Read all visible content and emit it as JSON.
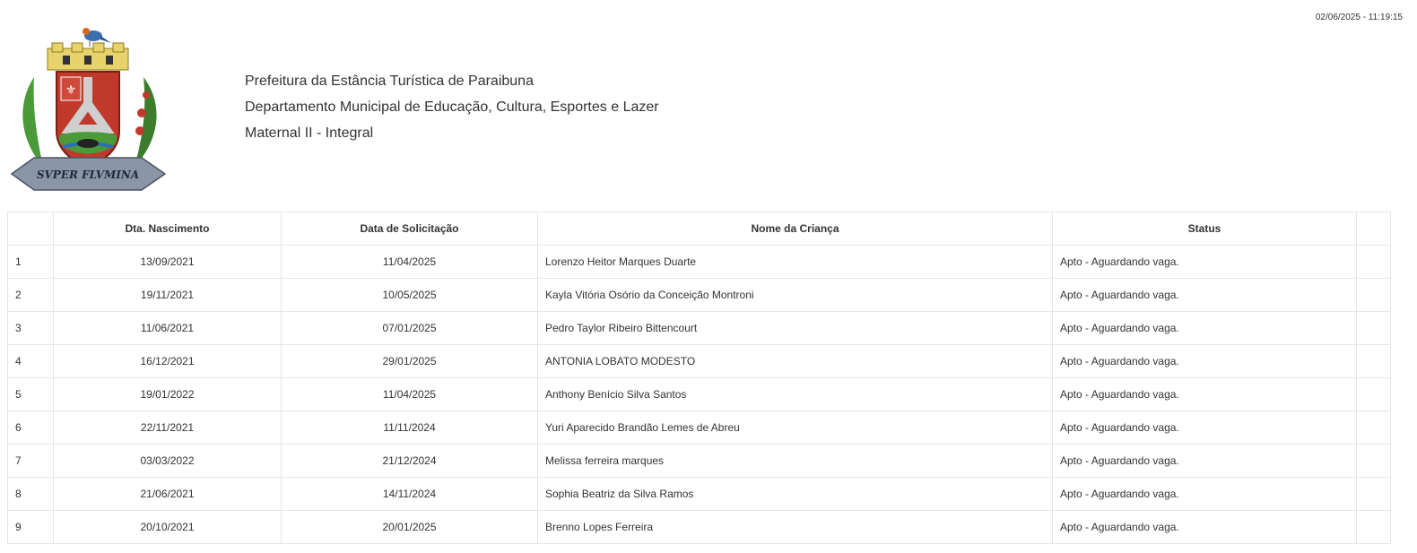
{
  "timestamp": "02/06/2025 - 11:19:15",
  "header": {
    "logo_motto": "SVPER FLVMINA",
    "lines": [
      "Prefeitura da Estância Turística de Paraibuna",
      "Departamento Municipal de Educação, Cultura, Esportes e Lazer",
      "Maternal II - Integral"
    ]
  },
  "table": {
    "columns": [
      "",
      "Dta. Nascimento",
      "Data de Solicitação",
      "Nome da Criança",
      "Status",
      ""
    ],
    "rows": [
      {
        "n": "1",
        "nascimento": "13/09/2021",
        "solicitacao": "11/04/2025",
        "nome": "Lorenzo Heitor Marques Duarte",
        "status": "Apto - Aguardando vaga."
      },
      {
        "n": "2",
        "nascimento": "19/11/2021",
        "solicitacao": "10/05/2025",
        "nome": "Kayla Vitória Osório da Conceição Montroni",
        "status": "Apto - Aguardando vaga."
      },
      {
        "n": "3",
        "nascimento": "11/06/2021",
        "solicitacao": "07/01/2025",
        "nome": "Pedro Taylor Ribeiro Bittencourt",
        "status": "Apto - Aguardando vaga."
      },
      {
        "n": "4",
        "nascimento": "16/12/2021",
        "solicitacao": "29/01/2025",
        "nome": "ANTONIA LOBATO MODESTO",
        "status": "Apto - Aguardando vaga."
      },
      {
        "n": "5",
        "nascimento": "19/01/2022",
        "solicitacao": "11/04/2025",
        "nome": "Anthony Benício Silva Santos",
        "status": "Apto - Aguardando vaga."
      },
      {
        "n": "6",
        "nascimento": "22/11/2021",
        "solicitacao": "11/11/2024",
        "nome": "Yuri Aparecido Brandão Lemes de Abreu",
        "status": "Apto - Aguardando vaga."
      },
      {
        "n": "7",
        "nascimento": "03/03/2022",
        "solicitacao": "21/12/2024",
        "nome": "Melissa ferreira marques",
        "status": "Apto - Aguardando vaga."
      },
      {
        "n": "8",
        "nascimento": "21/06/2021",
        "solicitacao": "14/11/2024",
        "nome": "Sophia Beatriz da Silva Ramos",
        "status": "Apto - Aguardando vaga."
      },
      {
        "n": "9",
        "nascimento": "20/10/2021",
        "solicitacao": "20/01/2025",
        "nome": "Brenno Lopes Ferreira",
        "status": "Apto - Aguardando vaga."
      }
    ]
  }
}
